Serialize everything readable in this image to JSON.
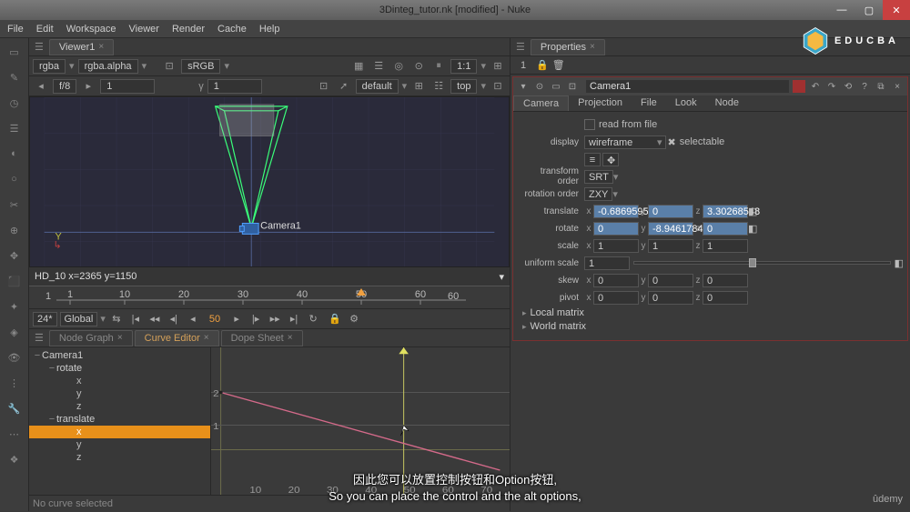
{
  "title": "3Dinteg_tutor.nk [modified] - Nuke",
  "menu": [
    "File",
    "Edit",
    "Workspace",
    "Viewer",
    "Render",
    "Cache",
    "Help"
  ],
  "viewerTab": "Viewer1",
  "channelBar": {
    "ch1": "rgba",
    "ch2": "rgba.alpha",
    "cs": "sRGB"
  },
  "viewerTop": {
    "fstop": "f/8",
    "xval": "1",
    "yval": "1",
    "proxy": "default",
    "view": "top",
    "ratio": "1:1"
  },
  "viewer": {
    "label": "Camera1",
    "info": "HD_10  x=2365 y=1150"
  },
  "timeline": {
    "ticks": [
      1,
      10,
      20,
      30,
      40,
      50,
      60
    ],
    "start": "1",
    "end": "60"
  },
  "transport": {
    "fps": "24*",
    "mode": "Global",
    "frame": "50"
  },
  "lowerTabs": {
    "ng": "Node Graph",
    "ce": "Curve Editor",
    "ds": "Dope Sheet"
  },
  "tree": {
    "root": "Camera1",
    "rotate": "rotate",
    "translate": "translate",
    "axes": [
      "x",
      "y",
      "z"
    ]
  },
  "curveTicks": {
    "y": [
      2,
      1
    ],
    "x": [
      10,
      20,
      30,
      40,
      50,
      60,
      70
    ]
  },
  "status": "No curve selected",
  "propTab": "Properties",
  "propCount": "1",
  "node": {
    "name": "Camera1",
    "tabs": [
      "Camera",
      "Projection",
      "File",
      "Look",
      "Node"
    ],
    "readFromFile": "read from file",
    "displayLab": "display",
    "displayVal": "wireframe",
    "selectable": "selectable",
    "transformOrderLab": "transform order",
    "transformOrderVal": "SRT",
    "rotationOrderLab": "rotation order",
    "rotationOrderVal": "ZXY",
    "translateLab": "translate",
    "tx": "-0.6869595",
    "ty": "0",
    "tz": "3.30268548",
    "rotateLab": "rotate",
    "rx": "0",
    "ry": "-8.9461784",
    "rz": "0",
    "scaleLab": "scale",
    "sx": "1",
    "sy": "1",
    "sz": "1",
    "uniformLab": "uniform scale",
    "uniform": "1",
    "skewLab": "skew",
    "skx": "0",
    "sky": "0",
    "skz": "0",
    "pivotLab": "pivot",
    "px": "0",
    "py": "0",
    "pz": "0",
    "localMatrix": "Local matrix",
    "worldMatrix": "World matrix"
  },
  "logo": "EDUCBA",
  "caption": {
    "zh": "因此您可以放置控制按钮和Option按钮,",
    "en": "So you can place the control and the alt options,"
  },
  "udemy": "ûdemy",
  "icons": {
    "min": "—",
    "max": "▢",
    "close": "✕",
    "play": "▶",
    "pause": "❚❚",
    "step": "▸",
    "gear": "⚙",
    "lock": "🔒",
    "refresh": "↻"
  }
}
